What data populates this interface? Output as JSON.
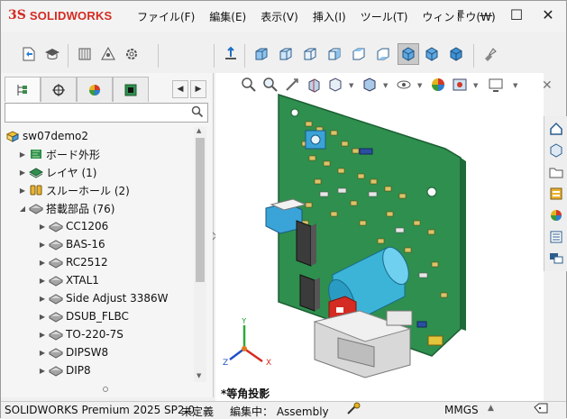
{
  "app": {
    "logo_ds": "3S",
    "logo_text": "SOLIDWORKS"
  },
  "menu": {
    "items": [
      "ファイル(F)",
      "編集(E)",
      "表示(V)",
      "挿入(I)",
      "ツール(T)",
      "ウィンドウ(W)"
    ]
  },
  "window_controls": {
    "minimize": "—",
    "maximize": "☐",
    "close": "✕"
  },
  "panel": {
    "filter_placeholder": "",
    "tree": {
      "root": "sw07demo2",
      "items": [
        {
          "label": "ボード外形",
          "expanded": false
        },
        {
          "label": "レイヤ (1)",
          "expanded": false
        },
        {
          "label": "スルーホール (2)",
          "expanded": false
        },
        {
          "label": "搭載部品 (76)",
          "expanded": true
        }
      ],
      "children": [
        "CC1206",
        "BAS-16",
        "RC2512",
        "XTAL1",
        "Side Adjust 3386W",
        "DSUB_FLBC",
        "TO-220-7S",
        "DIPSW8",
        "DIP8"
      ]
    }
  },
  "viewport": {
    "view_name": "*等角投影",
    "triad_labels": {
      "x": "X",
      "y": "Y",
      "z": "Z"
    }
  },
  "status": {
    "product": "SOLIDWORKS Premium 2025 SP2.0",
    "state": "未定義",
    "editing": "編集中： Assembly",
    "units": "MMGS"
  },
  "colors": {
    "accent": "#d42b22",
    "board": "#2f8f4e",
    "capacitor": "#3bb4d8",
    "selected_tool": "#c9c9c9"
  }
}
